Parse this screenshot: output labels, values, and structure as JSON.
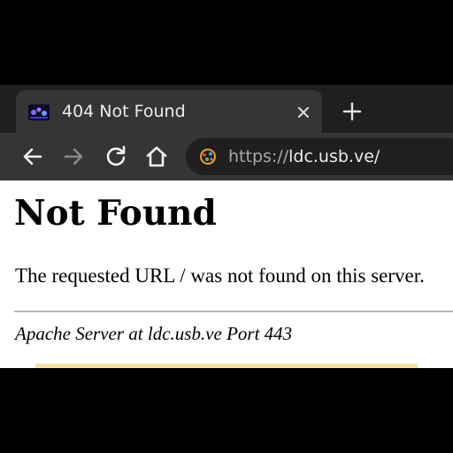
{
  "browser": {
    "tab": {
      "title": "404 Not Found",
      "favicon": "site-logo-icon",
      "close_icon": "close-icon"
    },
    "new_tab_icon": "plus-icon",
    "toolbar": {
      "back_icon": "arrow-left-icon",
      "forward_icon": "arrow-right-icon",
      "reload_icon": "reload-icon",
      "home_icon": "home-icon"
    },
    "address_bar": {
      "scheme": "https://",
      "host_path": "ldc.usb.ve/",
      "site_icon": "site-info-icon"
    }
  },
  "page": {
    "heading": "Not Found",
    "message": "The requested URL / was not found on this server.",
    "server_signature": "Apache Server at ldc.usb.ve Port 443"
  },
  "colors": {
    "frame_background": "#000000",
    "tabstrip": "#1f1f1f",
    "tab_active": "#353535",
    "toolbar": "#353535",
    "omnibox": "#1f1f1f",
    "page_background": "#ffffff",
    "forward_disabled": "#8a8a8a"
  }
}
